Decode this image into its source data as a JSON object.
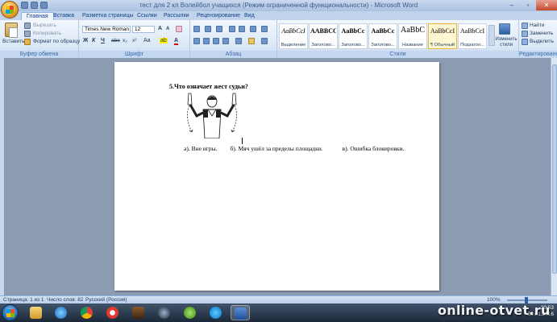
{
  "window": {
    "title": "тест для 2 кл Волейбол учащихся (Режим ограниченной функциональности) - Microsoft Word",
    "controls": {
      "minimize": "–",
      "maximize": "▫",
      "close": "✕"
    }
  },
  "ribbon_tabs": [
    "Главная",
    "Вставка",
    "Разметка страницы",
    "Ссылки",
    "Рассылки",
    "Рецензирование",
    "Вид"
  ],
  "clipboard": {
    "paste_label": "Вставить",
    "cut_label": "Вырезать",
    "copy_label": "Копировать",
    "format_painter_label": "Формат по образцу",
    "group_label": "Буфер обмена"
  },
  "font": {
    "family": "Times New Roman",
    "size": "12",
    "group_label": "Шрифт",
    "bold": "Ж",
    "italic": "К",
    "underline": "Ч",
    "strike": "abe",
    "subscript": "x₂",
    "superscript": "x²",
    "change_case": "Aa",
    "grow": "A",
    "shrink": "A",
    "highlight": "ab",
    "font_color": "A"
  },
  "paragraph": {
    "group_label": "Абзац"
  },
  "styles": {
    "group_label": "Стили",
    "items": [
      {
        "sample": "AaBbCcI",
        "name": "Выделение"
      },
      {
        "sample": "AABBCC",
        "name": "Заголово..."
      },
      {
        "sample": "AaBbCc",
        "name": "Заголово..."
      },
      {
        "sample": "AaBbCc",
        "name": "Заголово..."
      },
      {
        "sample": "AaBbC",
        "name": "Название"
      },
      {
        "sample": "AaBbCcI",
        "name": "¶ Обычный"
      },
      {
        "sample": "AaBbCcI",
        "name": "Подзагол..."
      }
    ],
    "change_styles_label": "Изменить стили"
  },
  "editing": {
    "find_label": "Найти",
    "replace_label": "Заменить",
    "select_label": "Выделить",
    "group_label": "Редактирование"
  },
  "document": {
    "question": "5.Что означает жест судьи?",
    "answers": [
      "а). Вне игры.",
      "б).  Мяч ушёл за пределы площадки.",
      "в). Ошибка блокировки."
    ]
  },
  "status_bar": {
    "page": "Страница: 1 из 1",
    "words": "Число слов: 82",
    "language": "Русский (Россия)",
    "zoom": "100%"
  },
  "taskbar": {
    "apps": [
      "explorer",
      "media-player",
      "chrome",
      "yandex",
      "game",
      "steam",
      "utorrent",
      "skype",
      "word"
    ],
    "time": "20:53",
    "date": "20.01.2016"
  },
  "watermark": "online-otvet.ru",
  "colors": {
    "ribbon_bg": "#dbe7f6",
    "doc_bg": "#8c9bb1",
    "accent": "#15428b"
  }
}
